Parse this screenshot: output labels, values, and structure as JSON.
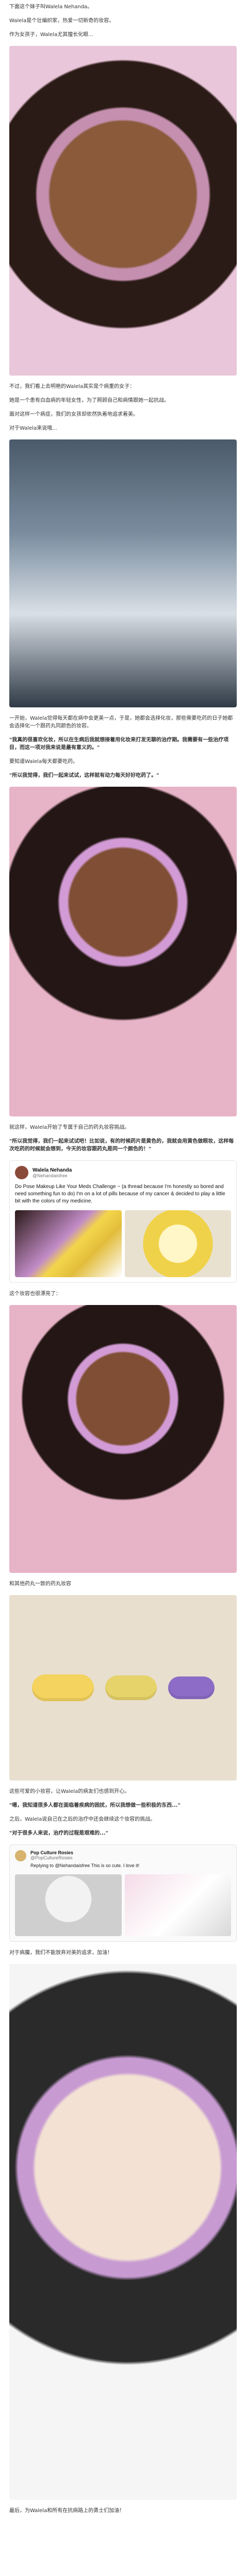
{
  "texts": [
    "下面这个妹子叫Walela Nehanda。",
    "Walela是个壮编织家，热爱一切新奇的妆容。",
    "作为女孩子，Walela尤其擅长化眼...",
    "不过，我们看上去明艳的Walela其实是个病重的女子：",
    "她是一个患有白血病的年轻女性，为了照顾自己和病情跟她一起抗战。",
    "面对这样一个病症，我们的女孩却依然执着地追求着美。",
    "对于Walela来说哦...",
    "一开始，Walela觉得每天都在病中会更美一点，于是，她都会选择化妆，那些需要吃药的日子她都会选择化一个跟药丸同颜色的妆容。",
    "\"我真的很喜欢化妆，所以在生病后我就想接着用化妆来打发无聊的治疗期。我需要有一些治疗项目，而这一项对我来说是最有意义的。\"",
    "要知道Walela每天都要吃药。",
    "\"所以我觉得，我们一起来试试，这样就有动力每天好好吃药了。\"",
    "就这样，Walela开始了专属于自己的药丸妆容挑战。",
    "\"所以我觉得，我们一起来试试吧！比如说，有的时候药片是黄色的，我就会用黄色做眼妆，这样每次吃药的时候就会想到，今天的妆容跟药丸是同一个颜色的！\"",
    "这个妆容也很漂亮了：",
    "和其他药丸一致的药丸妆容",
    "这些可爱的小妆容，让Walela的病友们也感到开心。",
    "\"嗯，我知道很多人都在面临着疾病的困扰，所以我想做一些积极的东西...\"",
    "之后，Walela说自己在之后的治疗中还会继续这个妆容的挑战。",
    "\"对于很多人来说，治疗的过程是艰难的...\"",
    "对于病魔，我们不能放弃对美的追求，加油！",
    "最后，为Walela和所有在抗病路上的勇士们加油！"
  ],
  "tweet_1": {
    "name": "Walela Nehanda",
    "handle": "@Nehandaisfree",
    "text": "Do Pose Makeup Like Your Meds Challenge ~ (a thread because I'm honestly so bored and need something fun to do) I'm on a lot of pills because of my cancer & decided to play a little bit with the colors of my medicine."
  },
  "tweet_2": {
    "name": "Pop Culture Rosies",
    "handle": "@PopCultureRosies",
    "text": "Replying to @Nehandaisfree This is so cute. I love it!"
  },
  "icons": {
    "avatar": "avatar-icon"
  }
}
